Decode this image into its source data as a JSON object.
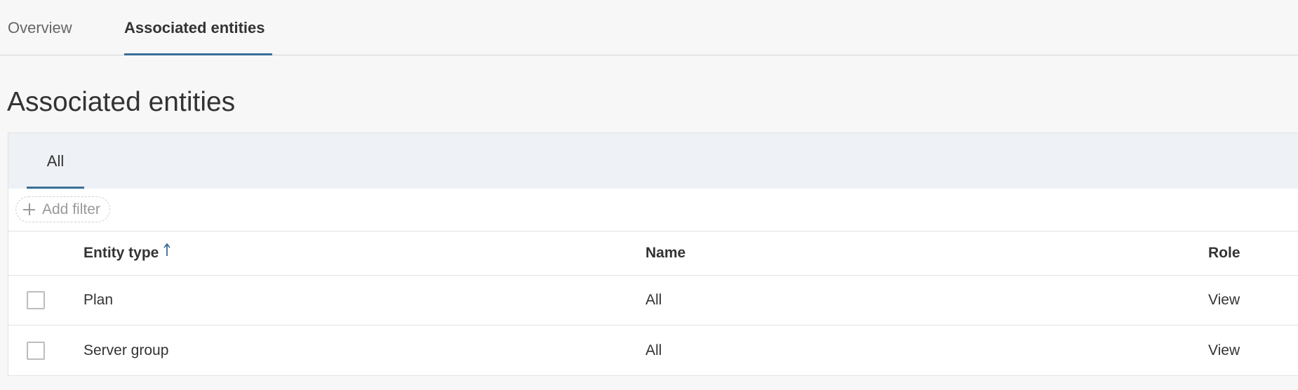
{
  "top_tabs": {
    "overview": "Overview",
    "associated": "Associated entities",
    "active": "associated"
  },
  "page": {
    "title": "Associated entities"
  },
  "sub_tabs": {
    "all": "All"
  },
  "filter": {
    "add_label": "Add filter"
  },
  "grid": {
    "columns": {
      "entity_type": "Entity type",
      "name": "Name",
      "role": "Role"
    },
    "sort": {
      "column": "entity_type",
      "direction": "ascending"
    },
    "rows": [
      {
        "entity_type": "Plan",
        "name": "All",
        "role": "View",
        "selected": false
      },
      {
        "entity_type": "Server group",
        "name": "All",
        "role": "View",
        "selected": false
      }
    ]
  },
  "colors": {
    "accent": "#3a6e96",
    "page_background": "#f7f7f7",
    "subtab_background": "#eef1f5",
    "border": "#e2e2e2"
  },
  "icons": {
    "add_filter": "plus-icon",
    "sort": "sort-ascending-icon"
  }
}
